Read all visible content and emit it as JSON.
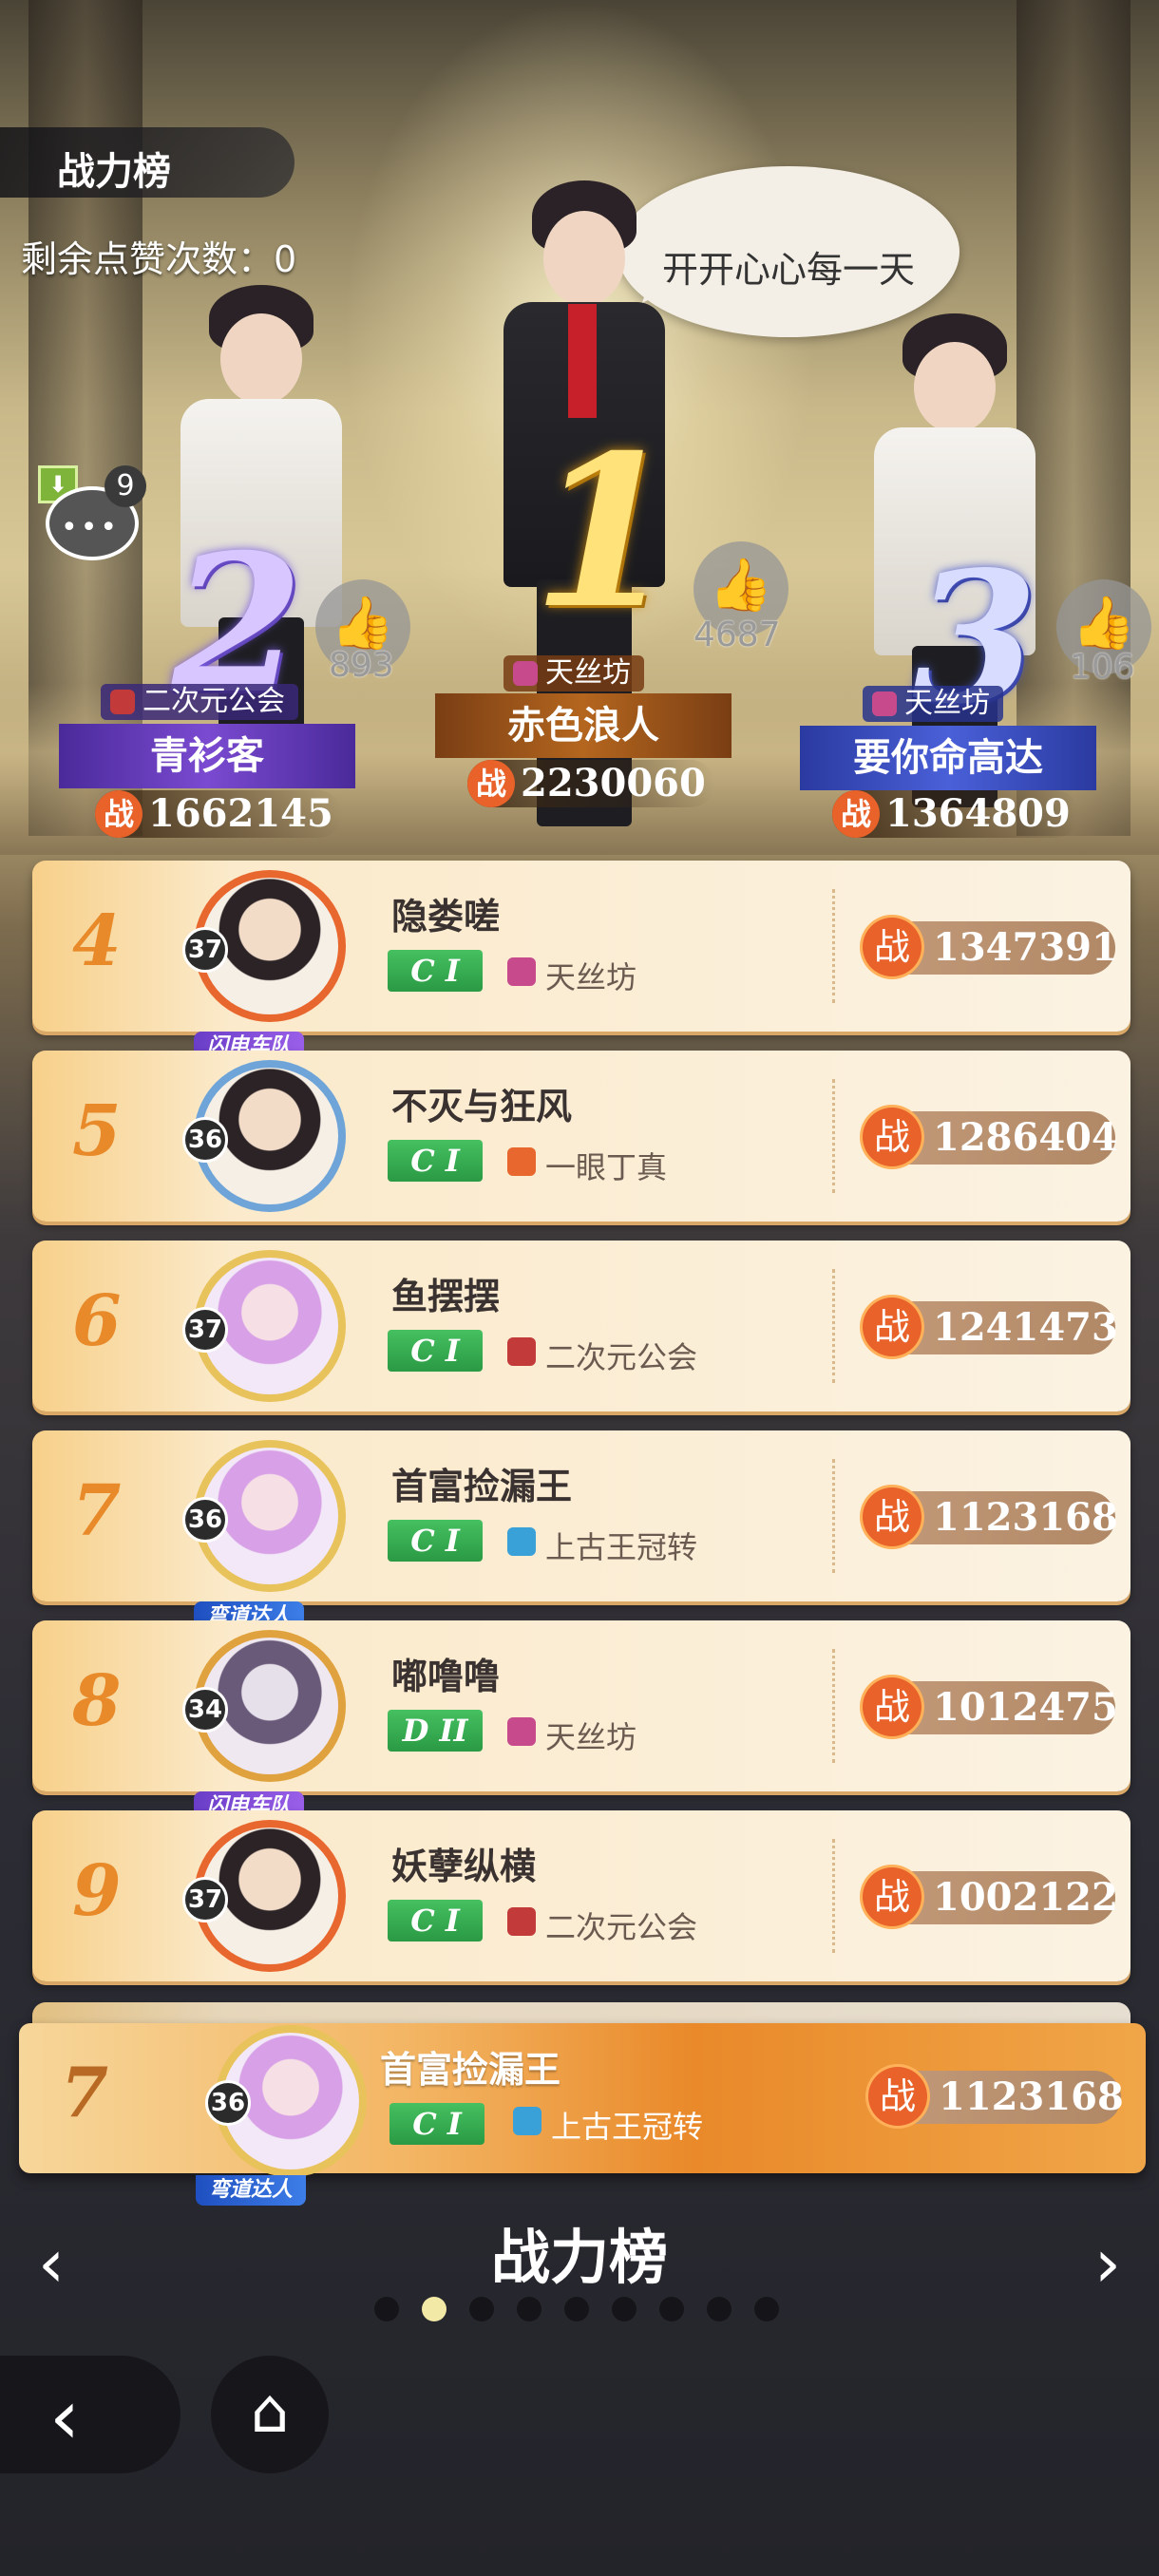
{
  "header": {
    "board_title": "战力榜",
    "likes_label": "剩余点赞次数：",
    "likes_value": "0",
    "chat_badge": "9",
    "chat_dots": "•••"
  },
  "podium": {
    "first": {
      "rank": "1",
      "name": "赤色浪人",
      "guild": "天丝坊",
      "power": "2230060",
      "likes": "4687",
      "speech": "开开心心每一天"
    },
    "second": {
      "rank": "2",
      "name": "青衫客",
      "guild": "二次元公会",
      "power": "1662145",
      "likes": "893"
    },
    "third": {
      "rank": "3",
      "name": "要你命高达",
      "guild": "天丝坊",
      "power": "1364809",
      "likes": "106"
    }
  },
  "zhan_label": "战",
  "thumb_glyph": "👍",
  "rows": [
    {
      "rank": "4",
      "level": "37",
      "name": "隐娄嗟",
      "grade": "C I",
      "guild": "天丝坊",
      "power": "1347391",
      "banner": "闪电车队"
    },
    {
      "rank": "5",
      "level": "36",
      "name": "不灭与狂风",
      "grade": "C I",
      "guild": "一眼丁真",
      "power": "1286404"
    },
    {
      "rank": "6",
      "level": "37",
      "name": "鱼摆摆",
      "grade": "C I",
      "guild": "二次元公会",
      "power": "1241473"
    },
    {
      "rank": "7",
      "level": "36",
      "name": "首富捡漏王",
      "grade": "C I",
      "guild": "上古王冠转",
      "power": "1123168",
      "banner": "弯道达人"
    },
    {
      "rank": "8",
      "level": "34",
      "name": "嘟噜噜",
      "grade": "D II",
      "guild": "天丝坊",
      "power": "1012475",
      "banner": "闪电车队"
    },
    {
      "rank": "9",
      "level": "37",
      "name": "妖孽纵横",
      "grade": "C I",
      "guild": "二次元公会",
      "power": "1002122"
    }
  ],
  "my_rank": {
    "rank": "7",
    "level": "36",
    "name": "首富捡漏王",
    "grade": "C I",
    "guild": "上古王冠转",
    "power": "1123168",
    "banner": "弯道达人"
  },
  "footer": {
    "title": "战力榜",
    "prev_glyph": "‹",
    "next_glyph": "›",
    "back_glyph": "‹",
    "home_glyph": "⌂"
  },
  "colors": {
    "guild_tiansi": "#c64a8c",
    "guild_ciyuan": "#c23a3a",
    "guild_yiyan": "#e8672e",
    "guild_shanggu": "#3aa0d8",
    "accent_orange": "#e8622a"
  }
}
